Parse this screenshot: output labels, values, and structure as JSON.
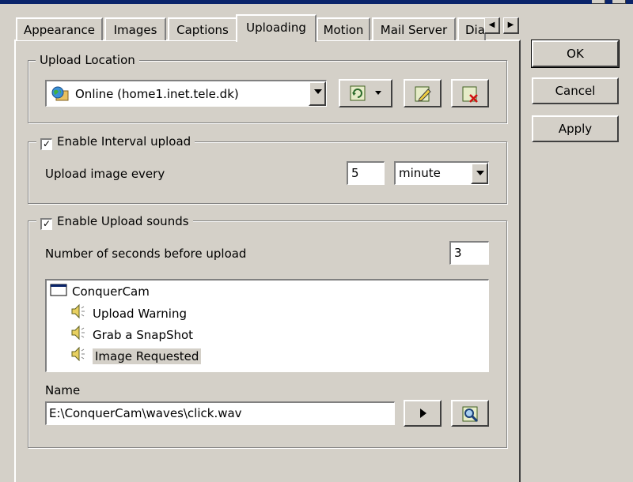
{
  "tabs": [
    "Appearance",
    "Images",
    "Captions",
    "Uploading",
    "Motion",
    "Mail Server",
    "Dia"
  ],
  "active_tab": "Uploading",
  "buttons": {
    "ok": "OK",
    "cancel": "Cancel",
    "apply": "Apply"
  },
  "upload_location": {
    "legend": "Upload Location",
    "selected": "Online (home1.inet.tele.dk)"
  },
  "interval": {
    "legend": "Enable Interval upload",
    "checked": true,
    "label": "Upload image every",
    "value": "5",
    "unit": "minute"
  },
  "sounds": {
    "legend": "Enable Upload sounds",
    "checked": true,
    "seconds_label": "Number of seconds before upload",
    "seconds_value": "3",
    "tree_root": "ConquerCam",
    "tree_items": [
      "Upload Warning",
      "Grab a SnapShot",
      "Image Requested"
    ],
    "selected_item": "Image Requested",
    "name_label": "Name",
    "name_value": "E:\\ConquerCam\\waves\\click.wav"
  },
  "icons": {
    "location_icon": "globe-folder-icon",
    "connect_icon": "refresh-icon",
    "edit_icon": "edit-icon",
    "delete_icon": "delete-icon",
    "play_icon": "play-icon",
    "browse_icon": "browse-icon",
    "speaker_icon": "speaker-icon",
    "window_icon": "window-icon"
  }
}
